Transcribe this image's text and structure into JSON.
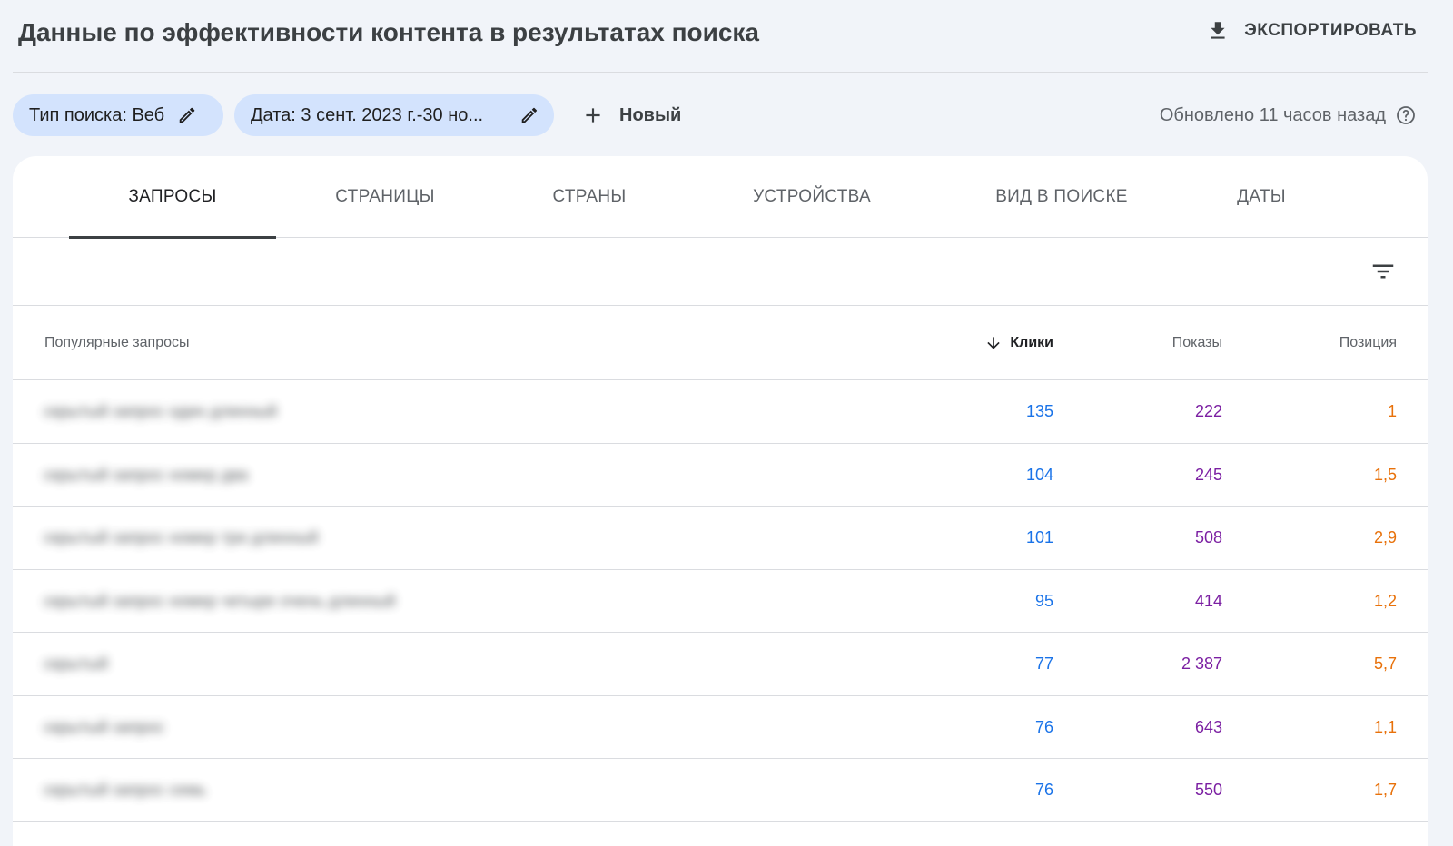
{
  "header": {
    "title": "Данные по эффективности контента в результатах поиска",
    "export_label": "ЭКСПОРТИРОВАТЬ"
  },
  "filters": {
    "search_type": "Тип поиска: Веб",
    "date_range": "Дата: 3 сент. 2023 г.-30 но...",
    "new_label": "Новый",
    "updated": "Обновлено 11 часов назад"
  },
  "tabs": [
    {
      "label": "ЗАПРОСЫ",
      "active": true
    },
    {
      "label": "СТРАНИЦЫ",
      "active": false
    },
    {
      "label": "СТРАНЫ",
      "active": false
    },
    {
      "label": "УСТРОЙСТВА",
      "active": false
    },
    {
      "label": "ВИД В ПОИСКЕ",
      "active": false
    },
    {
      "label": "ДАТЫ",
      "active": false
    }
  ],
  "table": {
    "columns": {
      "query": "Популярные запросы",
      "clicks": "Клики",
      "impressions": "Показы",
      "position": "Позиция"
    },
    "sort_column": "clicks",
    "rows": [
      {
        "query": "скрытый запрос один длинный",
        "clicks": "135",
        "impressions": "222",
        "position": "1"
      },
      {
        "query": "скрытый запрос номер два",
        "clicks": "104",
        "impressions": "245",
        "position": "1,5"
      },
      {
        "query": "скрытый запрос номер три длинный",
        "clicks": "101",
        "impressions": "508",
        "position": "2,9"
      },
      {
        "query": "скрытый запрос номер четыре очень длинный",
        "clicks": "95",
        "impressions": "414",
        "position": "1,2"
      },
      {
        "query": "скрытый",
        "clicks": "77",
        "impressions": "2 387",
        "position": "5,7"
      },
      {
        "query": "скрытый запрос",
        "clicks": "76",
        "impressions": "643",
        "position": "1,1"
      },
      {
        "query": "скрытый запрос семь",
        "clicks": "76",
        "impressions": "550",
        "position": "1,7"
      }
    ]
  },
  "colors": {
    "clicks": "#1a73e8",
    "impressions": "#7b1fa2",
    "position": "#e8710a",
    "chip_bg": "#d3e3fd"
  },
  "icons": {
    "export": "download-icon",
    "edit": "pencil-icon",
    "new": "plus-icon",
    "help": "help-circle-icon",
    "filter": "filter-list-icon",
    "sort": "arrow-down-icon"
  }
}
